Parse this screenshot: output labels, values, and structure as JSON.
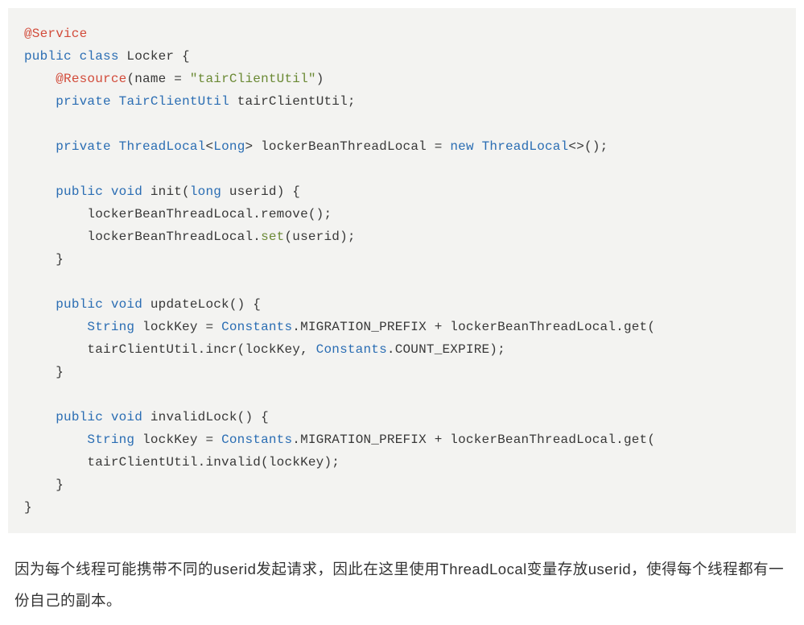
{
  "code": {
    "line1_annotation": "@Service",
    "line2_keyword": "public class",
    "line2_classname": " Locker ",
    "line2_brace": "{",
    "line3_indent": "    ",
    "line3_annotation": "@Resource",
    "line3_paren_open": "(name = ",
    "line3_string": "\"tairClientUtil\"",
    "line3_paren_close": ")",
    "line4_indent": "    ",
    "line4_keyword": "private",
    "line4_space": " ",
    "line4_type": "TairClientUtil",
    "line4_rest": " tairClientUtil;",
    "line5_blank": "",
    "line6_indent": "    ",
    "line6_keyword": "private",
    "line6_space1": " ",
    "line6_type1": "ThreadLocal",
    "line6_lt": "<",
    "line6_type2": "Long",
    "line6_gt": ">",
    "line6_var": " lockerBeanThreadLocal = ",
    "line6_new": "new",
    "line6_space2": " ",
    "line6_type3": "ThreadLocal",
    "line6_diamond": "<>();",
    "line7_blank": "",
    "line8_indent": "    ",
    "line8_keyword": "public void",
    "line8_method": " init(",
    "line8_param_type": "long",
    "line8_param_rest": " userid) {",
    "line9_indent": "        ",
    "line9_text": "lockerBeanThreadLocal.remove();",
    "line10_indent": "        ",
    "line10_prefix": "lockerBeanThreadLocal.",
    "line10_method": "set",
    "line10_suffix": "(userid);",
    "line11_indent": "    ",
    "line11_brace": "}",
    "line12_blank": "",
    "line13_indent": "    ",
    "line13_keyword": "public void",
    "line13_rest": " updateLock() {",
    "line14_indent": "        ",
    "line14_type": "String",
    "line14_var": " lockKey = ",
    "line14_const": "Constants",
    "line14_mid": ".MIGRATION_PREFIX + lockerBeanThreadLocal.get(",
    "line15_indent": "        ",
    "line15_prefix": "tairClientUtil.incr(lockKey, ",
    "line15_const": "Constants",
    "line15_suffix": ".COUNT_EXPIRE);",
    "line16_indent": "    ",
    "line16_brace": "}",
    "line17_blank": "",
    "line18_indent": "    ",
    "line18_keyword": "public void",
    "line18_rest": " invalidLock() {",
    "line19_indent": "        ",
    "line19_type": "String",
    "line19_var": " lockKey = ",
    "line19_const": "Constants",
    "line19_mid": ".MIGRATION_PREFIX + lockerBeanThreadLocal.get(",
    "line20_indent": "        ",
    "line20_text": "tairClientUtil.invalid(lockKey);",
    "line21_indent": "    ",
    "line21_brace": "}",
    "line22_brace": "}"
  },
  "paragraph": "因为每个线程可能携带不同的userid发起请求，因此在这里使用ThreadLocal变量存放userid，使得每个线程都有一份自己的副本。"
}
